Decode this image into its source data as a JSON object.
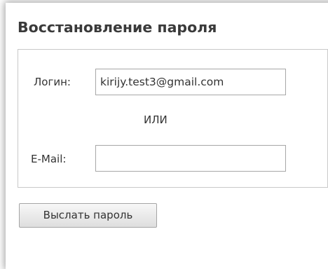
{
  "form": {
    "title": "Восстановление пароля",
    "login_label": "Логин:",
    "login_value": "kirijy.test3@gmail.com",
    "or_text": "ИЛИ",
    "email_label": "E-Mail:",
    "email_value": "",
    "submit_label": "Выслать пароль"
  }
}
